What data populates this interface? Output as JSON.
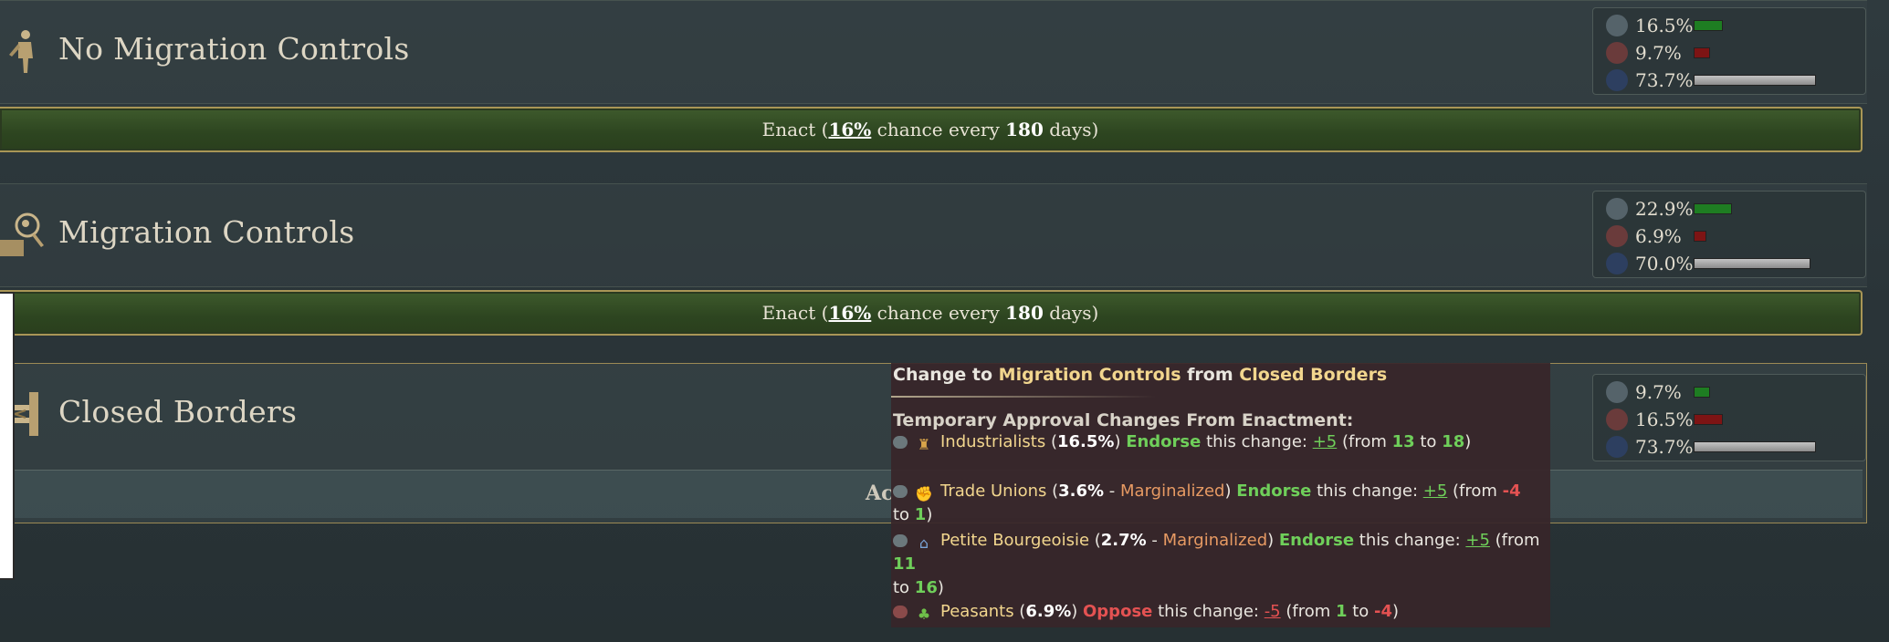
{
  "laws": [
    {
      "name": "No Migration Controls",
      "icon": "person-icon",
      "approve": "16.5%",
      "approve_frac": 0.16,
      "oppose": "9.7%",
      "oppose_frac": 0.09,
      "neutral": "73.7%",
      "neutral_frac": 0.74,
      "enact": {
        "prefix": "Enact (",
        "chance": "16%",
        "mid": " chance every ",
        "days": "180",
        "suffix": " days)"
      }
    },
    {
      "name": "Migration Controls",
      "icon": "inspector-icon",
      "approve": "22.9%",
      "approve_frac": 0.23,
      "oppose": "6.9%",
      "oppose_frac": 0.07,
      "neutral": "70.0%",
      "neutral_frac": 0.7,
      "enact": {
        "prefix": "Enact (",
        "chance": "16%",
        "mid": " chance every ",
        "days": "180",
        "suffix": " days)"
      }
    },
    {
      "name": "Closed Borders",
      "icon": "barrier-icon",
      "approve": "9.7%",
      "approve_frac": 0.1,
      "oppose": "16.5%",
      "oppose_frac": 0.17,
      "neutral": "73.7%",
      "neutral_frac": 0.74,
      "active_label": "Ac"
    }
  ],
  "tooltip": {
    "title_prefix": "Change to ",
    "title_to": "Migration Controls",
    "title_mid": " from ",
    "title_from": "Closed Borders",
    "heading": "Temporary Approval Changes From Enactment:",
    "lines": [
      {
        "stance_icon": "approve-icon",
        "group_icon": "factory-icon",
        "group": "Industrialists",
        "share": "16.5%",
        "status": "",
        "verdict": "Endorse",
        "change": "+5",
        "from": "13",
        "to": "18",
        "text_change": " this change: ",
        "text_from": " (from ",
        "text_to": " to ",
        "text_end": ")"
      },
      {
        "stance_icon": "approve-icon",
        "group_icon": "fist-icon",
        "group": "Trade Unions",
        "share": "3.6%",
        "status": "Marginalized",
        "verdict": "Endorse",
        "change": "+5",
        "from": "-4",
        "to": "1",
        "text_change": " this change: ",
        "text_from": " (from ",
        "text_to": " to ",
        "text_end": ")"
      },
      {
        "stance_icon": "approve-icon",
        "group_icon": "shop-icon",
        "group": "Petite Bourgeoisie",
        "share": "2.7%",
        "status": "Marginalized",
        "verdict": "Endorse",
        "change": "+5",
        "from": "11",
        "to": "16",
        "text_change": " this change: ",
        "text_from": " (from ",
        "text_to": " to ",
        "text_end": ")"
      },
      {
        "stance_icon": "disapprove-icon",
        "group_icon": "tree-icon",
        "group": "Peasants",
        "share": "6.9%",
        "status": "",
        "verdict": "Oppose",
        "change": "-5",
        "from": "1",
        "to": "-4",
        "text_change": " this change: ",
        "text_from": " (from ",
        "text_to": " to ",
        "text_end": ")"
      }
    ]
  },
  "colors": {
    "approve_bar": "#1e7d22",
    "oppose_bar": "#7d1414",
    "endorse": "#6fcf5a",
    "oppose": "#e45252",
    "marginalized": "#e79a63",
    "highlight": "#f2d68e"
  }
}
